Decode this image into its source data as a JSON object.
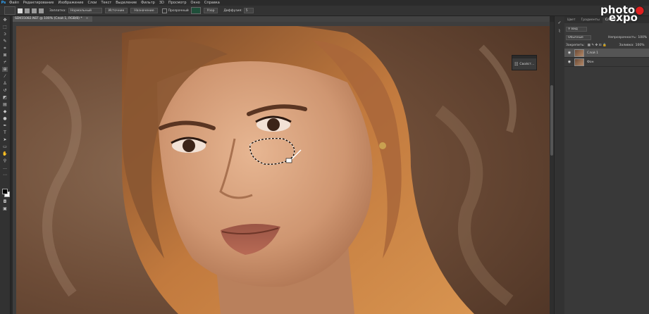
{
  "menubar": {
    "app_logo": "Ps",
    "items": [
      "Файл",
      "Редактирование",
      "Изображение",
      "Слои",
      "Текст",
      "Выделение",
      "Фильтр",
      "3D",
      "Просмотр",
      "Окно",
      "Справка"
    ]
  },
  "options": {
    "feather_label": "Заплатка:",
    "mode_value": "Нормальный",
    "source_label": "Источник",
    "dest_label": "Назначение",
    "transparent_label": "Прозрачный",
    "pattern_label": "Узор",
    "diffusion_label": "Диффузия:",
    "diffusion_value": "5"
  },
  "document": {
    "tab_title": "SDK55082.NEF @ 100% (Слой 1, RGB/8) *",
    "close": "×",
    "image_alt": "portrait photo with patch selection under the eye"
  },
  "float_panel": {
    "icon": "☷",
    "label": "Свойст..."
  },
  "panel": {
    "tabs": [
      "Цвет",
      "Градиенты",
      "Слои",
      "Каналы"
    ],
    "active_tab": 2,
    "kind_label": "Вид",
    "blend_mode": "Обычные",
    "opacity_label": "Непрозрачность:",
    "opacity_value": "100%",
    "lock_label": "Закрепить:",
    "fill_label": "Заливка:",
    "fill_value": "100%",
    "layers": [
      {
        "name": "Слой 1",
        "selected": true
      },
      {
        "name": "Фон",
        "selected": false
      }
    ]
  },
  "watermark": {
    "line1a": "photo",
    "line1b": "●",
    "line2": "expo"
  },
  "colors": {
    "accent": "#31a8ff",
    "panel_bg": "#393939",
    "canvas_bg": "#6b4a35"
  }
}
